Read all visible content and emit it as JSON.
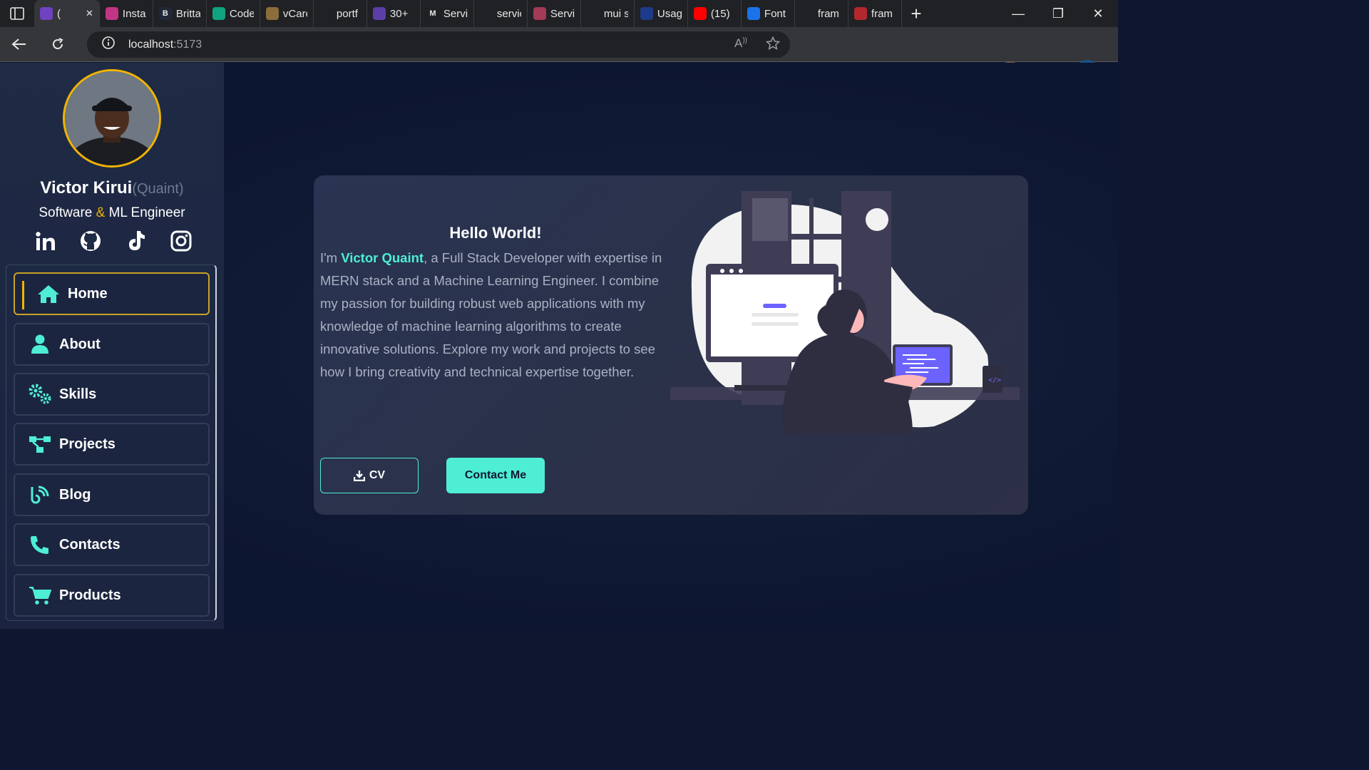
{
  "browser": {
    "tabs": [
      {
        "label": "(",
        "fav_color": "#6f42c1",
        "active": true
      },
      {
        "label": "Insta",
        "fav_color": "#c13584"
      },
      {
        "label": "Britta",
        "fav_color": "#1f2937",
        "fav_text": "B"
      },
      {
        "label": "Code",
        "fav_color": "#10a37f"
      },
      {
        "label": "vCarc",
        "fav_color": "#8a6d3b"
      },
      {
        "label": "portf",
        "fav_color": "#202124"
      },
      {
        "label": "30+",
        "fav_color": "#5b3fa6"
      },
      {
        "label": "Servi",
        "fav_color": "#202124",
        "fav_text": "M"
      },
      {
        "label": "servic",
        "fav_color": "#202124"
      },
      {
        "label": "Servi",
        "fav_color": "#a33a56"
      },
      {
        "label": "mui s",
        "fav_color": "#202124"
      },
      {
        "label": "Usag",
        "fav_color": "#1e3a8a"
      },
      {
        "label": "(15)",
        "fav_color": "#ff0000"
      },
      {
        "label": "Font",
        "fav_color": "#1a73e8"
      },
      {
        "label": "fram",
        "fav_color": "#202124"
      },
      {
        "label": "fram",
        "fav_color": "#b3282d"
      }
    ],
    "url_host": "localhost",
    "url_port": ":5173"
  },
  "profile": {
    "name": "Victor Kirui",
    "nickname": "(Quaint)",
    "role_part1": "Software ",
    "role_amp": "&",
    "role_part2": " ML Engineer"
  },
  "socials": [
    "linkedin-icon",
    "github-icon",
    "tiktok-icon",
    "instagram-icon"
  ],
  "menu": {
    "items": [
      {
        "label": "Home",
        "icon": "home-icon"
      },
      {
        "label": "About",
        "icon": "user-icon"
      },
      {
        "label": "Skills",
        "icon": "gears-icon"
      },
      {
        "label": "Projects",
        "icon": "diagram-icon"
      },
      {
        "label": "Blog",
        "icon": "blog-icon"
      },
      {
        "label": "Contacts",
        "icon": "phone-icon"
      },
      {
        "label": "Products",
        "icon": "cart-icon"
      }
    ],
    "active_index": 0
  },
  "hero": {
    "heading": "Hello World!",
    "intro_prefix": "I'm ",
    "intro_name": "Victor Quaint",
    "intro_rest": ", a Full Stack Developer with expertise in MERN stack and a Machine Learning Engineer. I combine my passion for building robust web applications with my knowledge of machine learning algorithms to create innovative solutions. Explore my work and projects to see how I bring creativity and technical expertise together.",
    "cv_label": "CV",
    "contact_label": "Contact Me"
  },
  "colors": {
    "accent": "#4eeed4",
    "gold": "#f0b400",
    "background": "#0f1730"
  }
}
